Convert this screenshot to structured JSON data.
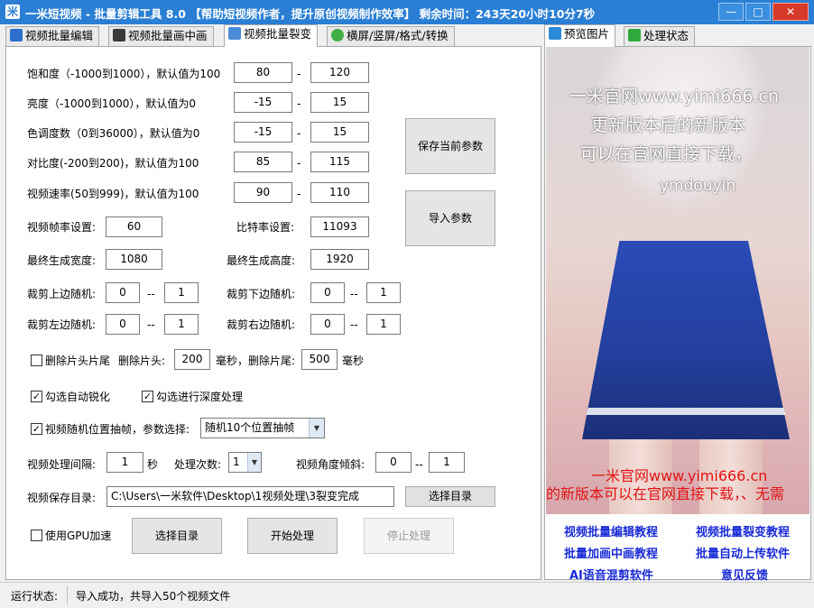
{
  "window": {
    "title": "一米短视频 - 批量剪辑工具 8.0 【帮助短视频作者，提升原创视频制作效率】 剩余时间：243天20小时10分7秒",
    "app_icon": "米",
    "minimize": "—",
    "maximize": "□",
    "close": "✕"
  },
  "left_tabs": [
    {
      "label": "视频批量编辑",
      "icon": "edit-icon"
    },
    {
      "label": "视频批量画中画",
      "icon": "pip-icon"
    },
    {
      "label": "视频批量裂变",
      "icon": "split-icon"
    },
    {
      "label": "横屏/竖屏/格式/转换",
      "icon": "convert-icon"
    }
  ],
  "right_tabs": [
    {
      "label": "预览图片",
      "icon": "image-icon"
    },
    {
      "label": "处理状态",
      "icon": "status-icon"
    }
  ],
  "params": {
    "saturation": {
      "label": "饱和度（-1000到1000），默认值为100",
      "min": "80",
      "max": "120"
    },
    "brightness": {
      "label": "亮度（-1000到1000），默认值为0",
      "min": "-15",
      "max": "15"
    },
    "hue": {
      "label": "色调度数（0到36000），默认值为0",
      "min": "-15",
      "max": "15"
    },
    "contrast": {
      "label": "对比度(-200到200)，默认值为100",
      "min": "85",
      "max": "115"
    },
    "speed": {
      "label": "视频速率(50到999)，默认值为100",
      "min": "90",
      "max": "110"
    },
    "dash": "-"
  },
  "buttons": {
    "save_params": "保存当前参数",
    "import_params": "导入参数",
    "select_dir_small": "选择目录",
    "select_dir_big": "选择目录",
    "start": "开始处理",
    "stop": "停止处理"
  },
  "settings": {
    "fps_label": "视频帧率设置:",
    "fps": "60",
    "bitrate_label": "比特率设置:",
    "bitrate": "11093",
    "width_label": "最终生成宽度:",
    "width": "1080",
    "height_label": "最终生成高度:",
    "height": "1920",
    "crop_top_label": "裁剪上边随机:",
    "crop_top_min": "0",
    "crop_top_max": "1",
    "crop_bottom_label": "裁剪下边随机:",
    "crop_bottom_min": "0",
    "crop_bottom_max": "1",
    "crop_left_label": "裁剪左边随机:",
    "crop_left_min": "0",
    "crop_left_max": "1",
    "crop_right_label": "裁剪右边随机:",
    "crop_right_min": "0",
    "crop_right_max": "1",
    "range_sep": "--",
    "trim_label": "删除片头片尾",
    "trim_checked": false,
    "trim_head_label": "删除片头:",
    "trim_head": "200",
    "trim_tail_label": "毫秒，删除片尾:",
    "trim_tail": "500",
    "ms_label": "毫秒",
    "sharpen_label": "勾选自动锐化",
    "sharpen_checked": true,
    "deep_label": "勾选进行深度处理",
    "deep_checked": true,
    "random_frame_label": "视频随机位置抽帧，参数选择:",
    "random_frame_checked": true,
    "random_frame_option": "随机10个位置抽帧",
    "interval_label": "视频处理间隔:",
    "interval": "1",
    "interval_unit": "秒",
    "times_label": "处理次数:",
    "times": "1",
    "tilt_label": "视频角度倾斜:",
    "tilt_min": "0",
    "tilt_max": "1",
    "save_dir_label": "视频保存目录:",
    "save_dir": "C:\\Users\\一米软件\\Desktop\\1视频处理\\3裂变完成",
    "gpu_label": "使用GPU加速",
    "gpu_checked": false,
    "check_mark": "✓"
  },
  "preview": {
    "overlay_lines": [
      "一米官网www.yimi666.cn",
      "更新版本后的新版本",
      "可以在官网直接下载，",
      "ymdouyin"
    ],
    "red_lines": [
      "一米官网www.yimi666.cn",
      "的新版本可以在官网直接下载，、无需"
    ]
  },
  "links": [
    "视频批量编辑教程",
    "视频批量裂变教程",
    "批量加画中画教程",
    "批量自动上传软件",
    "AI语音混剪软件",
    "意见反馈"
  ],
  "status": {
    "label": "运行状态:",
    "text": "导入成功，共导入50个视频文件"
  },
  "colors": {
    "titlebar": "#2a7fd4",
    "link": "#1a2bd6",
    "watermark_red": "#e01414"
  }
}
